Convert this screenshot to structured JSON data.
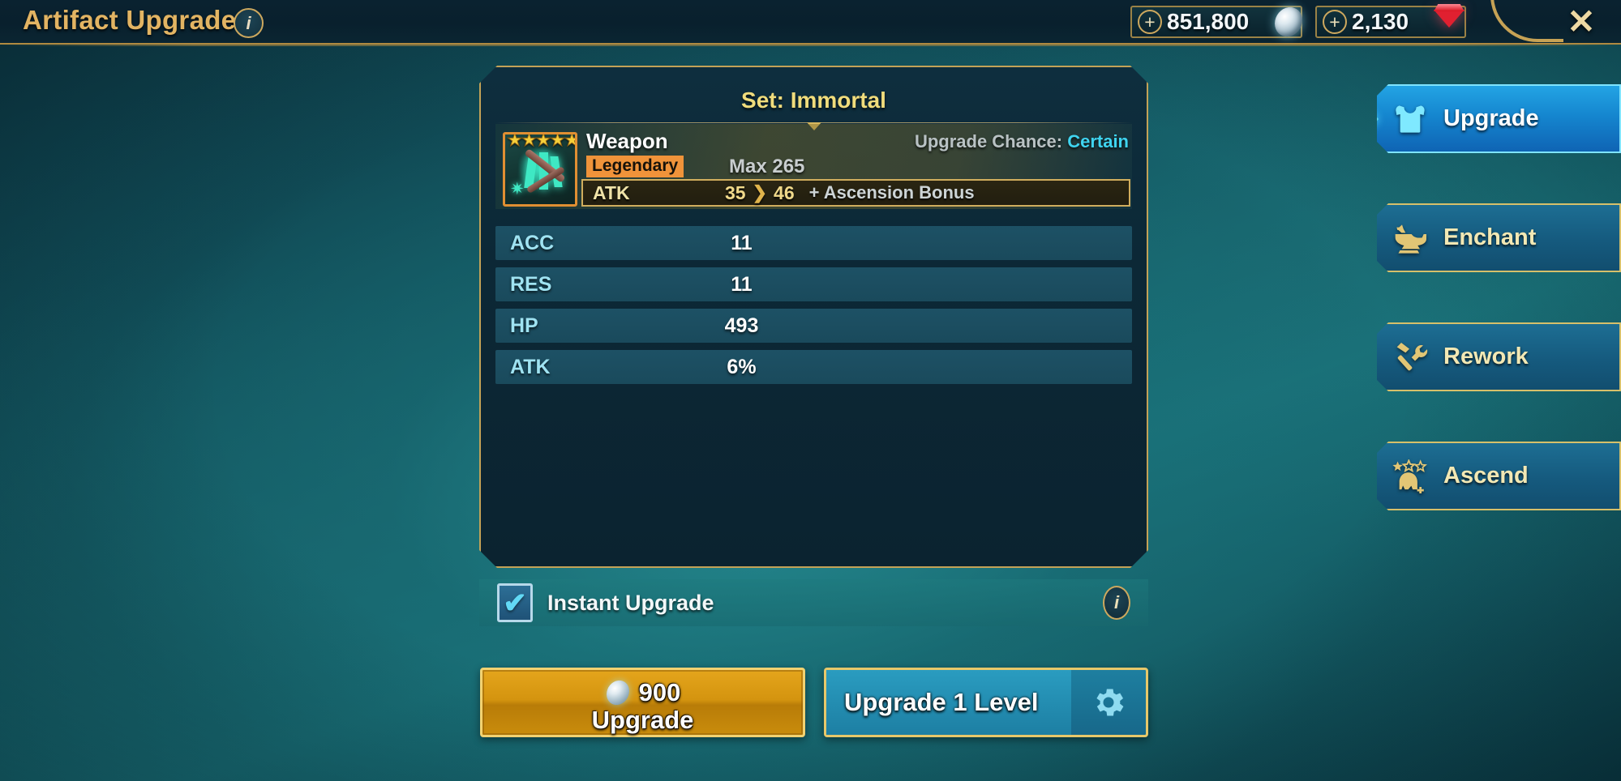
{
  "header": {
    "title": "Artifact Upgrade",
    "info_icon": "info-icon",
    "info_glyph": "i",
    "close_glyph": "✕",
    "currencies": [
      {
        "id": "silver",
        "plus": "+",
        "value": "851,800",
        "icon": "silver-coin-icon"
      },
      {
        "id": "gems",
        "plus": "+",
        "value": "2,130",
        "icon": "red-gem-icon"
      }
    ]
  },
  "artifact": {
    "set_label": "Set: Immortal",
    "type": "Weapon",
    "rarity": "Legendary",
    "max_label": "Max 265",
    "upgrade_chance_label": "Upgrade Chance: ",
    "upgrade_chance_value": "Certain",
    "stars": 5,
    "icon_name": "legendary-trident-weapon-icon",
    "main_stat": {
      "name": "ATK",
      "from": "35",
      "arrow": "❯",
      "to": "46",
      "bonus": "+ Ascension Bonus"
    },
    "substats": [
      {
        "name": "ACC",
        "value": "11"
      },
      {
        "name": "RES",
        "value": "11"
      },
      {
        "name": "HP",
        "value": "493"
      },
      {
        "name": "ATK",
        "value": "6%"
      }
    ]
  },
  "options": {
    "instant_upgrade_label": "Instant Upgrade",
    "instant_upgrade_checked": true,
    "check_glyph": "✔",
    "info_glyph": "i"
  },
  "actions": {
    "upgrade_cost": "900",
    "upgrade_label": "Upgrade",
    "level_label": "Upgrade 1 Level",
    "gear_glyph": "✦"
  },
  "nav": {
    "items": [
      {
        "label": "Upgrade",
        "icon": "armor-chest-icon",
        "active": true
      },
      {
        "label": "Enchant",
        "icon": "anvil-icon",
        "active": false
      },
      {
        "label": "Rework",
        "icon": "hammer-wrench-icon",
        "active": false
      },
      {
        "label": "Ascend",
        "icon": "star-helmet-icon",
        "active": false
      }
    ]
  },
  "colors": {
    "gold": "#d6c06a",
    "accent_cyan": "#3fd4f0",
    "legendary_orange": "#f0933a",
    "panel_bg": "#0c2836",
    "background_teal": "#15616b"
  }
}
